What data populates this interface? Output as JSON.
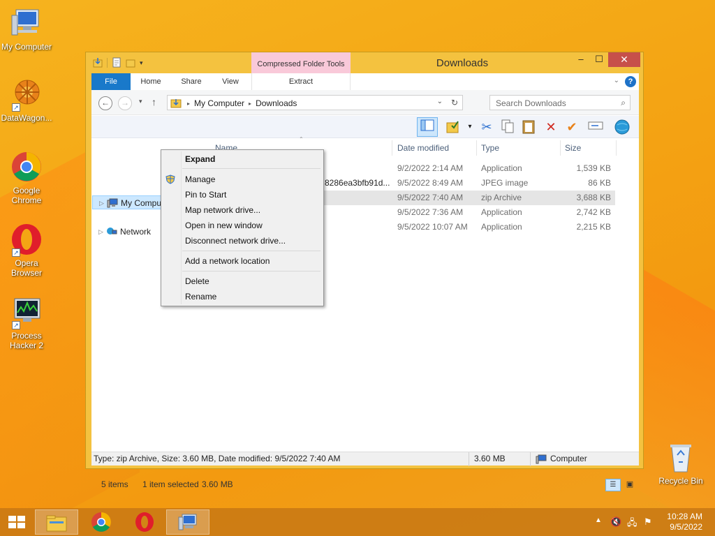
{
  "desktop": {
    "icons": [
      {
        "label": "My Computer"
      },
      {
        "label": "DataWagon..."
      },
      {
        "label": "Google Chrome"
      },
      {
        "label": "Opera Browser"
      },
      {
        "label": "Process Hacker 2"
      },
      {
        "label": "Recycle Bin"
      }
    ]
  },
  "window": {
    "title": "Downloads",
    "contextual_tab_group": "Compressed Folder Tools",
    "tabs": [
      "File",
      "Home",
      "Share",
      "View",
      "Extract"
    ],
    "address": {
      "crumbs": [
        "My Computer",
        "Downloads"
      ]
    },
    "search_placeholder": "Search Downloads",
    "columns": {
      "name": "Name",
      "date": "Date modified",
      "type": "Type",
      "size": "Size"
    },
    "nav": [
      {
        "label": "My Computer",
        "selected": true
      },
      {
        "label": "Network",
        "selected": false
      }
    ],
    "files": [
      {
        "name": "",
        "date": "9/2/2022 2:14 AM",
        "type": "Application",
        "size": "1,539 KB",
        "selected": false
      },
      {
        "name": "8286ea3bfb91d...",
        "date": "9/5/2022 8:49 AM",
        "type": "JPEG image",
        "size": "86 KB",
        "selected": false
      },
      {
        "name": "",
        "date": "9/5/2022 7:40 AM",
        "type": "zip Archive",
        "size": "3,688 KB",
        "selected": true
      },
      {
        "name": "",
        "date": "9/5/2022 7:36 AM",
        "type": "Application",
        "size": "2,742 KB",
        "selected": false
      },
      {
        "name": "",
        "date": "9/5/2022 10:07 AM",
        "type": "Application",
        "size": "2,215 KB",
        "selected": false
      }
    ],
    "status": {
      "items": "5 items",
      "selected": "1 item selected",
      "selected_size": "3.60 MB"
    },
    "details": {
      "text": "Type: zip Archive, Size: 3.60 MB, Date modified: 9/5/2022 7:40 AM",
      "size": "3.60 MB",
      "location": "Computer"
    }
  },
  "context_menu": {
    "items": [
      "Expand",
      "Manage",
      "Pin to Start",
      "Map network drive...",
      "Open in new window",
      "Disconnect network drive...",
      "Add a network location",
      "Delete",
      "Rename"
    ]
  },
  "taskbar": {
    "time": "10:28 AM",
    "date": "9/5/2022"
  }
}
